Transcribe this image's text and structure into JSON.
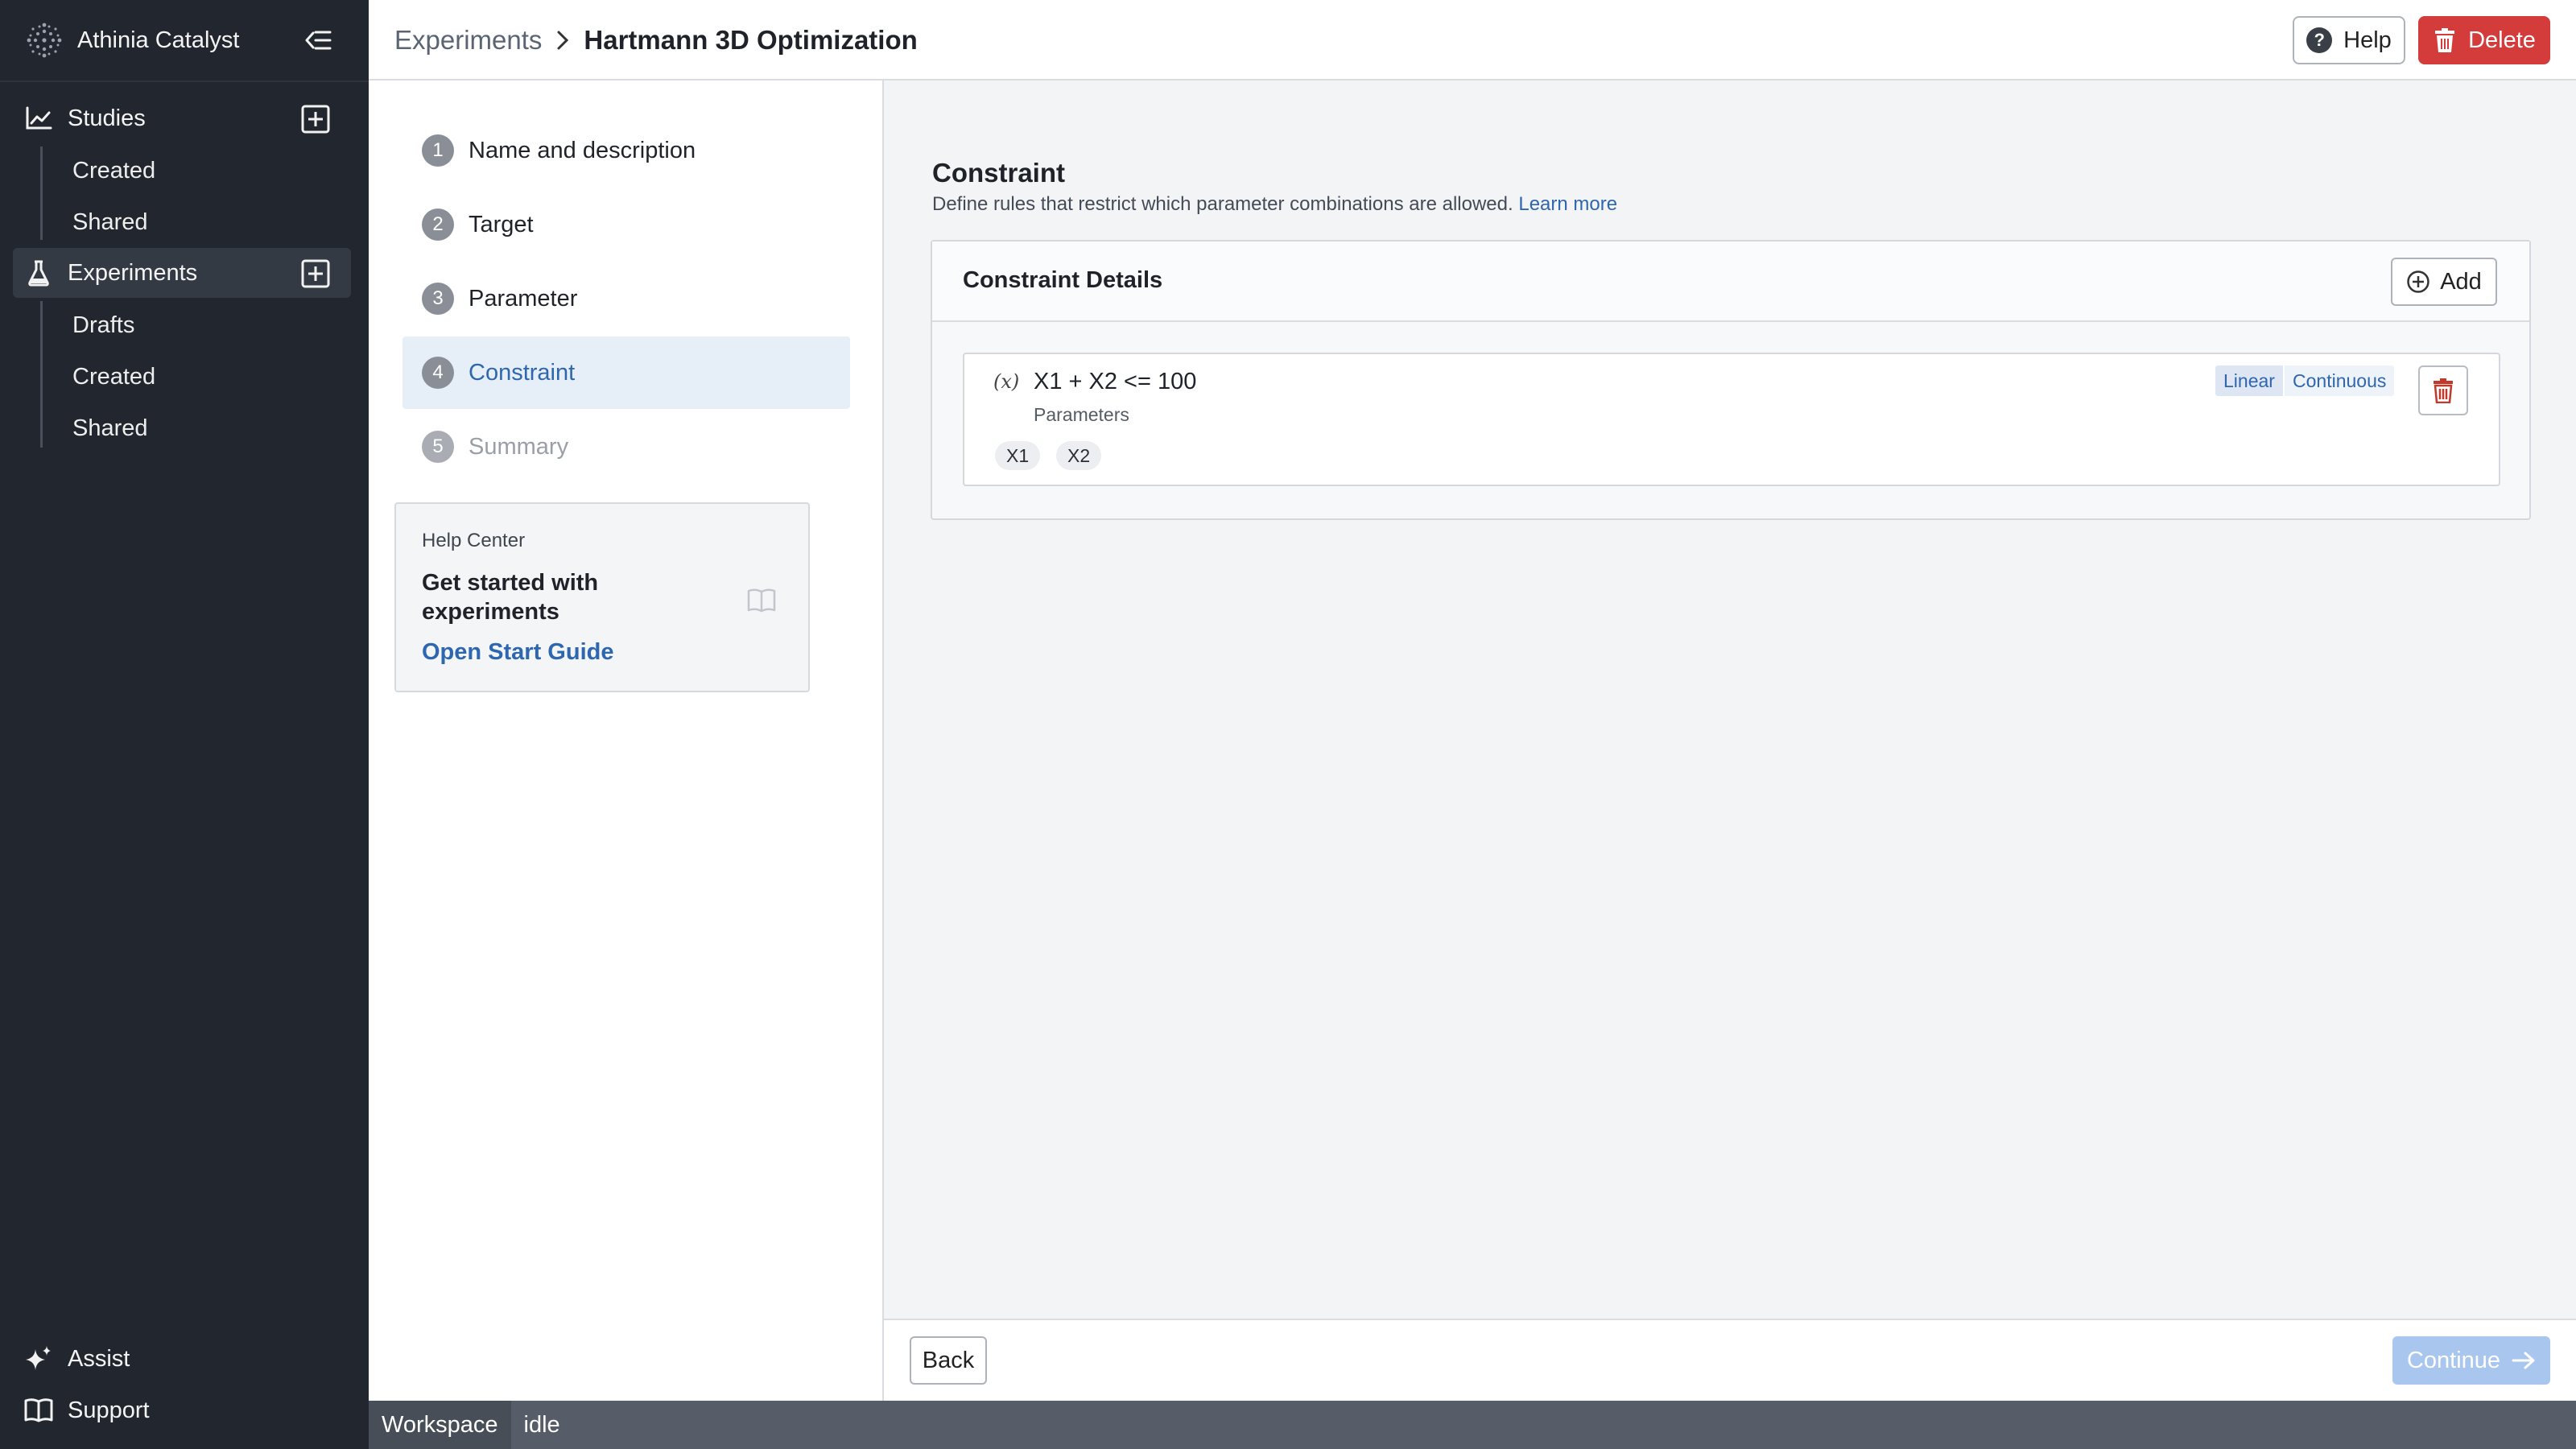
{
  "app": {
    "name": "Athinia Catalyst"
  },
  "sidebar": {
    "studies": {
      "label": "Studies",
      "items": [
        "Created",
        "Shared"
      ]
    },
    "experiments": {
      "label": "Experiments",
      "items": [
        "Drafts",
        "Created",
        "Shared"
      ]
    },
    "footer": {
      "assist": "Assist",
      "support": "Support"
    }
  },
  "header": {
    "breadcrumb_root": "Experiments",
    "breadcrumb_current": "Hartmann 3D Optimization",
    "help_label": "Help",
    "delete_label": "Delete"
  },
  "steps": [
    {
      "num": "1",
      "label": "Name and description"
    },
    {
      "num": "2",
      "label": "Target"
    },
    {
      "num": "3",
      "label": "Parameter"
    },
    {
      "num": "4",
      "label": "Constraint"
    },
    {
      "num": "5",
      "label": "Summary"
    }
  ],
  "help_center": {
    "label": "Help Center",
    "title": "Get started with experiments",
    "link": "Open Start Guide"
  },
  "constraint_section": {
    "title": "Constraint",
    "description": "Define rules that restrict which parameter combinations are allowed.",
    "learn_more": "Learn more",
    "card_title": "Constraint Details",
    "add_label": "Add",
    "item": {
      "icon": "(x)",
      "expression": "X1 + X2 <= 100",
      "sub_label": "Parameters",
      "parameters": [
        "X1",
        "X2"
      ],
      "tags": [
        "Linear",
        "Continuous"
      ]
    }
  },
  "actions": {
    "back": "Back",
    "continue": "Continue"
  },
  "status": {
    "workspace": "Workspace",
    "state": "idle"
  },
  "colors": {
    "sidebar_bg": "#22262e",
    "accent": "#2e66b0",
    "danger": "#d43b3b",
    "continue_disabled": "#a8c6ee"
  }
}
